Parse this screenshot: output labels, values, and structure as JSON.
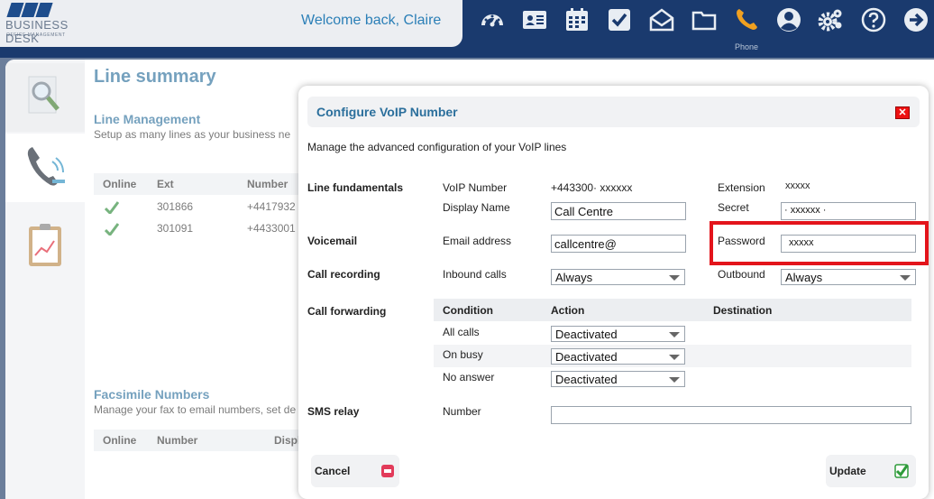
{
  "brand": {
    "name": "BUSINESS DESK",
    "tagline": "OFFICE MANAGEMENT"
  },
  "header": {
    "welcome": "Welcome back, Claire"
  },
  "nav": {
    "items": [
      "dashboard-icon",
      "contacts-icon",
      "calendar-icon",
      "tasks-icon",
      "mail-icon",
      "folder-icon",
      "phone-icon",
      "user-icon",
      "settings-icon",
      "help-icon",
      "logout-icon"
    ],
    "phone_label": "Phone",
    "active_color": "#f0a020"
  },
  "page": {
    "title": "Line summary",
    "line_management": {
      "heading": "Line Management",
      "subtitle": "Setup as many lines as your business ne",
      "columns": [
        "Online",
        "Ext",
        "Number"
      ],
      "rows": [
        {
          "ext": "301866",
          "number": "+4417932"
        },
        {
          "ext": "301091",
          "number": "+4433001"
        }
      ]
    },
    "facsimile": {
      "heading": "Facsimile Numbers",
      "subtitle": "Manage your fax to email numbers, set de",
      "columns": [
        "Online",
        "Number",
        "Displ"
      ]
    }
  },
  "modal": {
    "title": "Configure VoIP Number",
    "intro": "Manage the advanced configuration of your VoIP lines",
    "sections": {
      "fundamentals": "Line fundamentals",
      "voicemail": "Voicemail",
      "recording": "Call recording",
      "forwarding": "Call forwarding",
      "sms": "SMS relay"
    },
    "fields": {
      "voip_number_label": "VoIP Number",
      "voip_number_value": "+443300·   xxxxxx",
      "display_name_label": "Display Name",
      "display_name_value": "Call Centre",
      "extension_label": "Extension",
      "extension_value": "xxxxx",
      "secret_label": "Secret",
      "secret_value": "· xxxxxx  ·",
      "email_label": "Email address",
      "email_value": "callcentre@",
      "password_label": "Password",
      "password_value": "xxxxx",
      "inbound_label": "Inbound calls",
      "inbound_value": "Always",
      "outbound_label": "Outbound",
      "outbound_value": "Always",
      "sms_number_label": "Number",
      "sms_number_value": ""
    },
    "forwarding": {
      "columns": [
        "Condition",
        "Action",
        "Destination"
      ],
      "rows": [
        {
          "condition": "All calls",
          "action": "Deactivated"
        },
        {
          "condition": "On busy",
          "action": "Deactivated"
        },
        {
          "condition": "No answer",
          "action": "Deactivated"
        }
      ]
    },
    "buttons": {
      "cancel": "Cancel",
      "update": "Update"
    },
    "highlight_color": "#e3141b"
  }
}
